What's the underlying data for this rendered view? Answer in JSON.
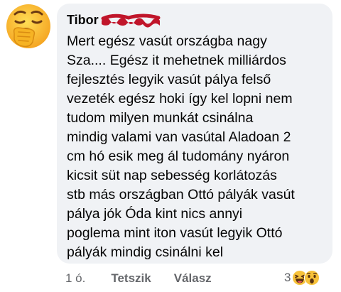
{
  "comment": {
    "author_visible": "Tibor",
    "text": "Mert egész vasút országba nagy\nSza.... Egész it mehetnek milliárdos\nfejlesztés legyik vasút pálya felső\nvezeték egész hoki így kel lopni nem\ntudom milyen munkát csinálna\nmindig valami van vasútal Aladoan 2\ncm hó esik meg ál tudomány nyáron\nkicsit süt nap sebesség korlátozás\nstb más országban Ottó pályák vasút\npálya jók Óda kint nics annyi\npoglema mint iton vasút legyik Ottó\npályák mindig csinálni kel"
  },
  "actions": {
    "time": "1 ó.",
    "like_label": "Tetszik",
    "reply_label": "Válasz"
  },
  "reactions": {
    "count": "3",
    "icons": [
      "haha-icon",
      "wow-icon"
    ]
  },
  "colors": {
    "bubble_bg": "#f0f2f5",
    "secondary_text": "#65676b",
    "emoji_yellow": "#f7c23a",
    "redaction": "#c0152a"
  }
}
